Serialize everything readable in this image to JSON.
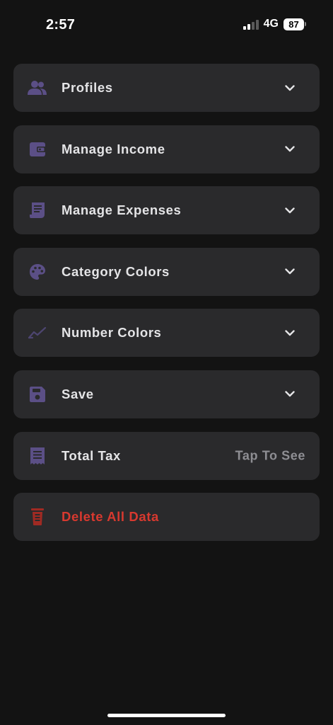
{
  "status_bar": {
    "time": "2:57",
    "network": "4G",
    "battery": "87"
  },
  "colors": {
    "background": "#131313",
    "card": "#2a2a2c",
    "icon_accent": "#5b4f86",
    "danger": "#d8392f",
    "trailing_text": "#8e8e93"
  },
  "menu": {
    "items": [
      {
        "label": "Profiles",
        "icon": "people-icon",
        "chevron": true
      },
      {
        "label": "Manage Income",
        "icon": "wallet-icon",
        "chevron": true
      },
      {
        "label": "Manage Expenses",
        "icon": "receipt-icon",
        "chevron": true
      },
      {
        "label": "Category Colors",
        "icon": "palette-icon",
        "chevron": true
      },
      {
        "label": "Number Colors",
        "icon": "trending-line-icon",
        "chevron": true
      },
      {
        "label": "Save",
        "icon": "save-icon",
        "chevron": true
      },
      {
        "label": "Total Tax",
        "icon": "tax-receipt-icon",
        "trailing": "Tap To See"
      },
      {
        "label": "Delete All Data",
        "icon": "delete-icon",
        "danger": true
      }
    ]
  }
}
